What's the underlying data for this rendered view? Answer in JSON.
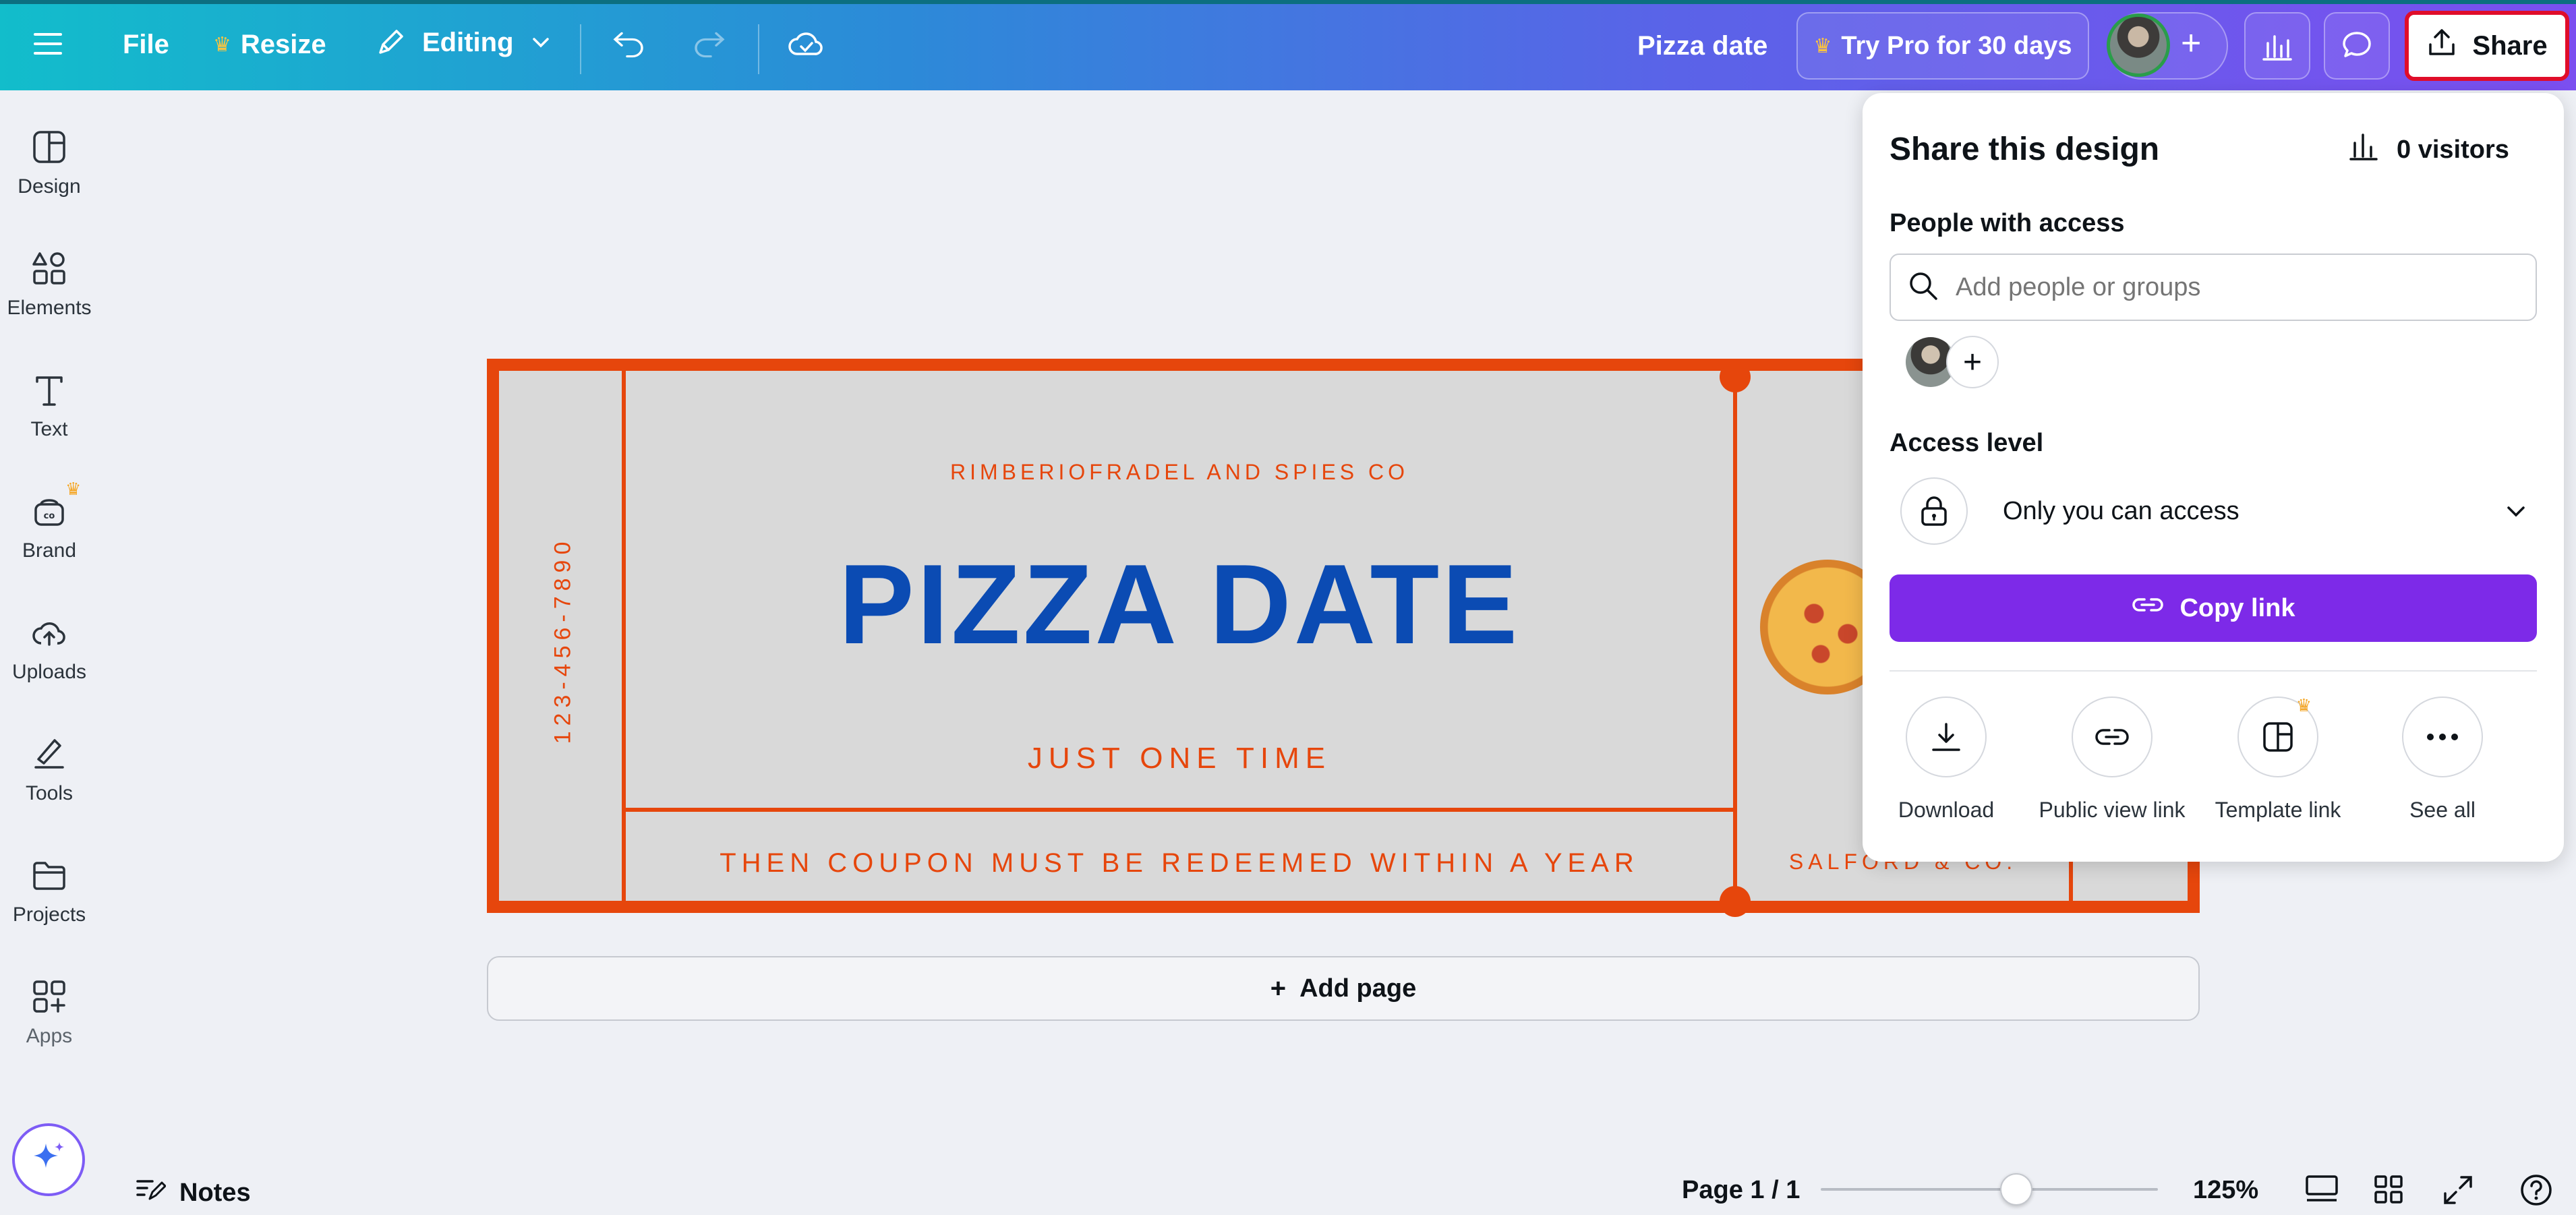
{
  "topbar": {
    "file": "File",
    "resize": "Resize",
    "editing": "Editing",
    "doc_title": "Pizza date",
    "try_pro": "Try Pro for 30 days",
    "share": "Share"
  },
  "sidebar": {
    "items": [
      {
        "label": "Design",
        "icon": "design-icon"
      },
      {
        "label": "Elements",
        "icon": "elements-icon"
      },
      {
        "label": "Text",
        "icon": "text-icon"
      },
      {
        "label": "Brand",
        "icon": "brand-icon"
      },
      {
        "label": "Uploads",
        "icon": "uploads-icon"
      },
      {
        "label": "Tools",
        "icon": "tools-icon"
      },
      {
        "label": "Projects",
        "icon": "projects-icon"
      },
      {
        "label": "Apps",
        "icon": "apps-icon"
      }
    ]
  },
  "ticket": {
    "company": "RIMBERIOFRADEL AND SPIES CO",
    "title": "PIZZA DATE",
    "subtitle": "JUST ONE TIME",
    "footer": "THEN COUPON MUST BE REDEEMED WITHIN A YEAR",
    "phone": "123-456-7890",
    "stub_text": "SALFORD & CO."
  },
  "add_page": "Add page",
  "share_panel": {
    "title": "Share this design",
    "visitors": "0 visitors",
    "people_label": "People with access",
    "search_placeholder": "Add people or groups",
    "access_label": "Access level",
    "access_value": "Only you can access",
    "copy_link": "Copy link",
    "actions": [
      {
        "label": "Download",
        "icon": "download-icon"
      },
      {
        "label": "Public view link",
        "icon": "link-icon"
      },
      {
        "label": "Template link",
        "icon": "template-icon"
      },
      {
        "label": "See all",
        "icon": "more-icon"
      }
    ]
  },
  "bottombar": {
    "notes": "Notes",
    "page": "Page 1 / 1",
    "zoom": "125%",
    "zoom_level": 0.58
  },
  "colors": {
    "accent_purple": "#7d2ae8",
    "ticket_orange": "#e6460c",
    "ticket_blue": "#0b4bb3",
    "share_highlight": "#e00d2a"
  }
}
